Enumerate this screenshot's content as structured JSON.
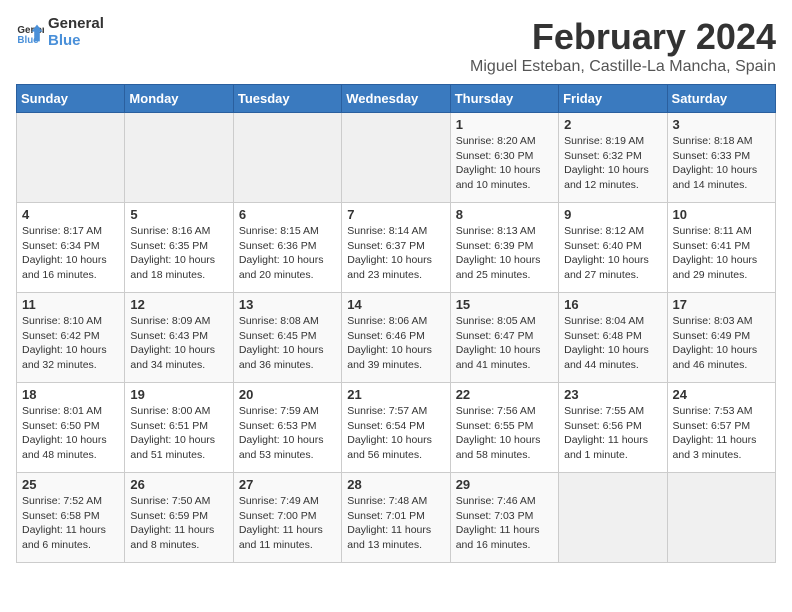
{
  "logo": {
    "text_general": "General",
    "text_blue": "Blue"
  },
  "header": {
    "title": "February 2024",
    "subtitle": "Miguel Esteban, Castille-La Mancha, Spain"
  },
  "weekdays": [
    "Sunday",
    "Monday",
    "Tuesday",
    "Wednesday",
    "Thursday",
    "Friday",
    "Saturday"
  ],
  "weeks": [
    [
      {
        "day": "",
        "info": ""
      },
      {
        "day": "",
        "info": ""
      },
      {
        "day": "",
        "info": ""
      },
      {
        "day": "",
        "info": ""
      },
      {
        "day": "1",
        "info": "Sunrise: 8:20 AM\nSunset: 6:30 PM\nDaylight: 10 hours\nand 10 minutes."
      },
      {
        "day": "2",
        "info": "Sunrise: 8:19 AM\nSunset: 6:32 PM\nDaylight: 10 hours\nand 12 minutes."
      },
      {
        "day": "3",
        "info": "Sunrise: 8:18 AM\nSunset: 6:33 PM\nDaylight: 10 hours\nand 14 minutes."
      }
    ],
    [
      {
        "day": "4",
        "info": "Sunrise: 8:17 AM\nSunset: 6:34 PM\nDaylight: 10 hours\nand 16 minutes."
      },
      {
        "day": "5",
        "info": "Sunrise: 8:16 AM\nSunset: 6:35 PM\nDaylight: 10 hours\nand 18 minutes."
      },
      {
        "day": "6",
        "info": "Sunrise: 8:15 AM\nSunset: 6:36 PM\nDaylight: 10 hours\nand 20 minutes."
      },
      {
        "day": "7",
        "info": "Sunrise: 8:14 AM\nSunset: 6:37 PM\nDaylight: 10 hours\nand 23 minutes."
      },
      {
        "day": "8",
        "info": "Sunrise: 8:13 AM\nSunset: 6:39 PM\nDaylight: 10 hours\nand 25 minutes."
      },
      {
        "day": "9",
        "info": "Sunrise: 8:12 AM\nSunset: 6:40 PM\nDaylight: 10 hours\nand 27 minutes."
      },
      {
        "day": "10",
        "info": "Sunrise: 8:11 AM\nSunset: 6:41 PM\nDaylight: 10 hours\nand 29 minutes."
      }
    ],
    [
      {
        "day": "11",
        "info": "Sunrise: 8:10 AM\nSunset: 6:42 PM\nDaylight: 10 hours\nand 32 minutes."
      },
      {
        "day": "12",
        "info": "Sunrise: 8:09 AM\nSunset: 6:43 PM\nDaylight: 10 hours\nand 34 minutes."
      },
      {
        "day": "13",
        "info": "Sunrise: 8:08 AM\nSunset: 6:45 PM\nDaylight: 10 hours\nand 36 minutes."
      },
      {
        "day": "14",
        "info": "Sunrise: 8:06 AM\nSunset: 6:46 PM\nDaylight: 10 hours\nand 39 minutes."
      },
      {
        "day": "15",
        "info": "Sunrise: 8:05 AM\nSunset: 6:47 PM\nDaylight: 10 hours\nand 41 minutes."
      },
      {
        "day": "16",
        "info": "Sunrise: 8:04 AM\nSunset: 6:48 PM\nDaylight: 10 hours\nand 44 minutes."
      },
      {
        "day": "17",
        "info": "Sunrise: 8:03 AM\nSunset: 6:49 PM\nDaylight: 10 hours\nand 46 minutes."
      }
    ],
    [
      {
        "day": "18",
        "info": "Sunrise: 8:01 AM\nSunset: 6:50 PM\nDaylight: 10 hours\nand 48 minutes."
      },
      {
        "day": "19",
        "info": "Sunrise: 8:00 AM\nSunset: 6:51 PM\nDaylight: 10 hours\nand 51 minutes."
      },
      {
        "day": "20",
        "info": "Sunrise: 7:59 AM\nSunset: 6:53 PM\nDaylight: 10 hours\nand 53 minutes."
      },
      {
        "day": "21",
        "info": "Sunrise: 7:57 AM\nSunset: 6:54 PM\nDaylight: 10 hours\nand 56 minutes."
      },
      {
        "day": "22",
        "info": "Sunrise: 7:56 AM\nSunset: 6:55 PM\nDaylight: 10 hours\nand 58 minutes."
      },
      {
        "day": "23",
        "info": "Sunrise: 7:55 AM\nSunset: 6:56 PM\nDaylight: 11 hours\nand 1 minute."
      },
      {
        "day": "24",
        "info": "Sunrise: 7:53 AM\nSunset: 6:57 PM\nDaylight: 11 hours\nand 3 minutes."
      }
    ],
    [
      {
        "day": "25",
        "info": "Sunrise: 7:52 AM\nSunset: 6:58 PM\nDaylight: 11 hours\nand 6 minutes."
      },
      {
        "day": "26",
        "info": "Sunrise: 7:50 AM\nSunset: 6:59 PM\nDaylight: 11 hours\nand 8 minutes."
      },
      {
        "day": "27",
        "info": "Sunrise: 7:49 AM\nSunset: 7:00 PM\nDaylight: 11 hours\nand 11 minutes."
      },
      {
        "day": "28",
        "info": "Sunrise: 7:48 AM\nSunset: 7:01 PM\nDaylight: 11 hours\nand 13 minutes."
      },
      {
        "day": "29",
        "info": "Sunrise: 7:46 AM\nSunset: 7:03 PM\nDaylight: 11 hours\nand 16 minutes."
      },
      {
        "day": "",
        "info": ""
      },
      {
        "day": "",
        "info": ""
      }
    ]
  ]
}
